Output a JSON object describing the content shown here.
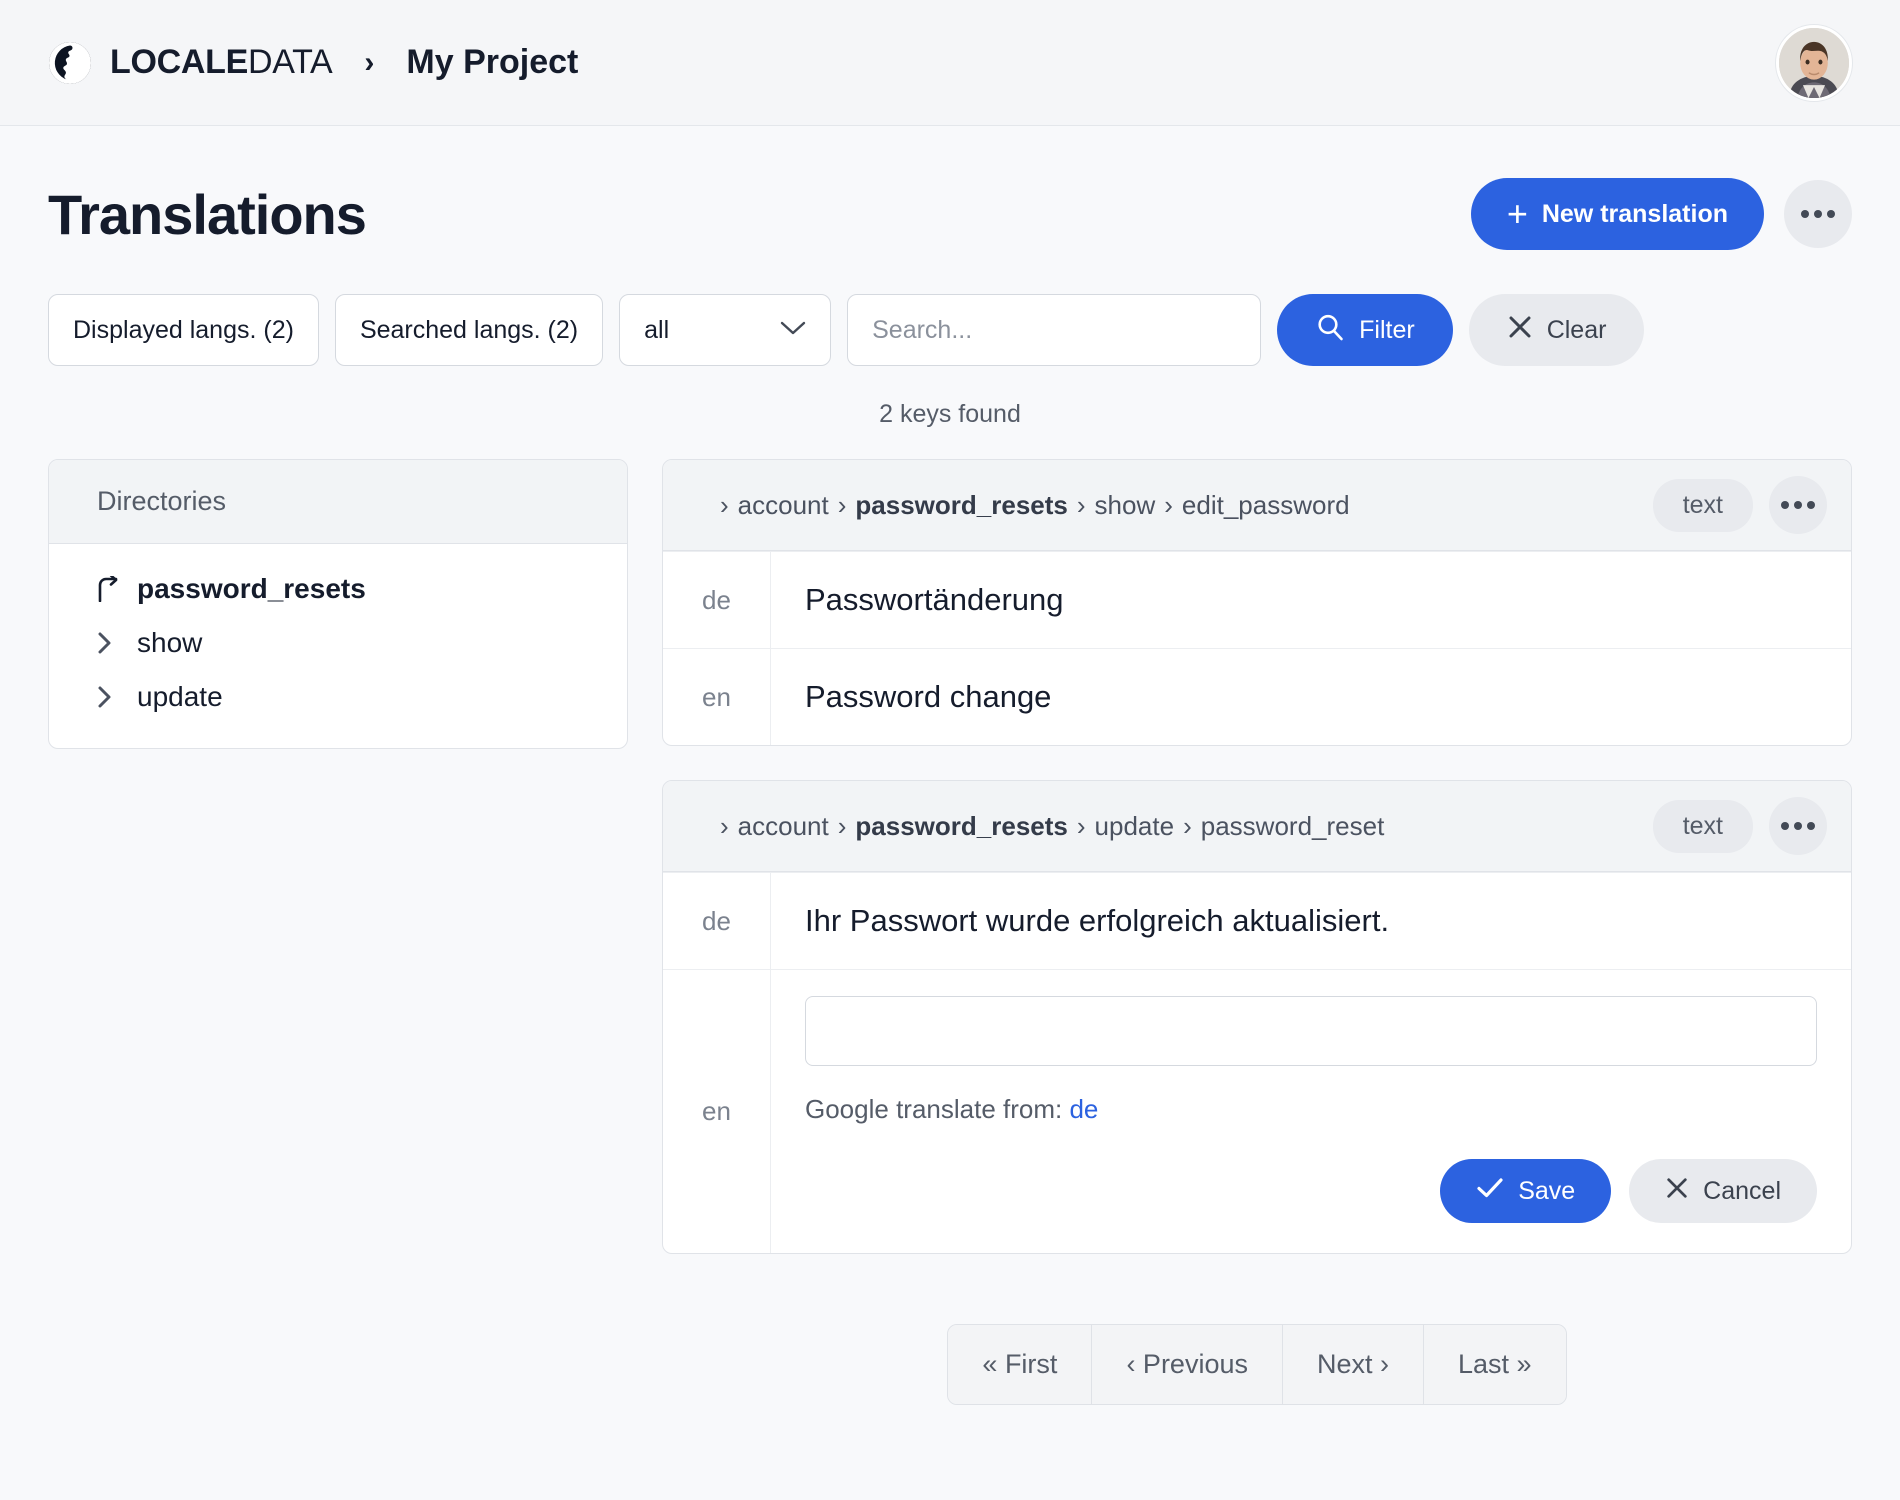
{
  "header": {
    "brand_strong": "LOCALE",
    "brand_light": "DATA",
    "separator": "›",
    "project": "My Project",
    "globe_icon": "globe-icon",
    "avatar_alt": "user-avatar"
  },
  "page": {
    "title": "Translations",
    "new_translation_label": "New translation",
    "plus": "+",
    "more_label": "•••",
    "keys_found": "2 keys found"
  },
  "filters": {
    "displayed_langs": "Displayed langs. (2)",
    "searched_langs": "Searched langs. (2)",
    "scope_selected": "all",
    "scope_options": [
      "all"
    ],
    "search_value": "",
    "search_placeholder": "Search...",
    "filter_label": "Filter",
    "clear_label": "Clear"
  },
  "directories": {
    "title": "Directories",
    "items": [
      {
        "label": "password_resets",
        "icon": "arrow-up-left-icon",
        "bold": true
      },
      {
        "label": "show",
        "icon": "chevron-right-icon",
        "bold": false
      },
      {
        "label": "update",
        "icon": "chevron-right-icon",
        "bold": false
      }
    ]
  },
  "keys": [
    {
      "breadcrumb": [
        "account",
        "password_resets",
        "show",
        "edit_password"
      ],
      "bold_index": 1,
      "badge": "text",
      "rows": [
        {
          "lang": "de",
          "value": "Passwortänderung",
          "editing": false
        },
        {
          "lang": "en",
          "value": "Password change",
          "editing": false
        }
      ]
    },
    {
      "breadcrumb": [
        "account",
        "password_resets",
        "update",
        "password_reset"
      ],
      "bold_index": 1,
      "badge": "text",
      "rows": [
        {
          "lang": "de",
          "value": "Ihr Passwort wurde erfolgreich aktualisiert.",
          "editing": false
        },
        {
          "lang": "en",
          "value": "",
          "editing": true,
          "google_translate_prefix": "Google translate from:",
          "google_translate_lang": "de",
          "save_label": "Save",
          "cancel_label": "Cancel"
        }
      ]
    }
  ],
  "pagination": {
    "first": "« First",
    "previous": "‹ Previous",
    "next": "Next ›",
    "last": "Last »"
  },
  "colors": {
    "accent": "#2c62e0",
    "page_bg": "#f8f9fb",
    "panel_bg": "#ffffff",
    "muted_text": "#555c68",
    "chip_bg": "#e8eaee"
  }
}
